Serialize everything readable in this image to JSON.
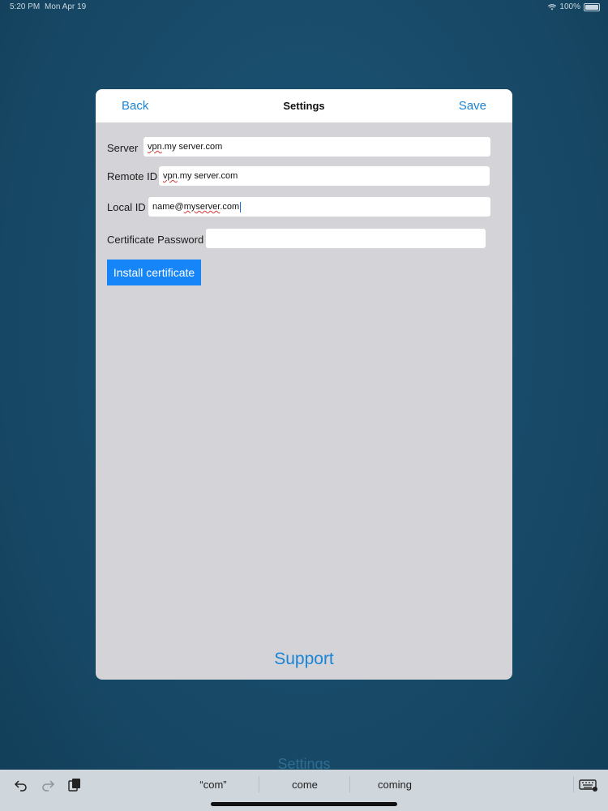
{
  "status_bar": {
    "time": "5:20 PM",
    "date": "Mon Apr 19",
    "battery": "100%"
  },
  "background_title": "Settings",
  "navbar": {
    "back": "Back",
    "title": "Settings",
    "save": "Save"
  },
  "form": {
    "server": {
      "label": "Server",
      "value_prefix": "vpn",
      "value_rest": ".my server.com"
    },
    "remote_id": {
      "label": "Remote ID",
      "value_prefix": "vpn",
      "value_rest": ".my server.com"
    },
    "local_id": {
      "label": "Local ID",
      "value_a": "name@",
      "value_b": "myserver",
      "value_c": ".com"
    },
    "certificate_password": {
      "label": "Certificate Password",
      "value": ""
    },
    "install_button": "Install certificate"
  },
  "support_link": "Support",
  "keyboard_bar": {
    "suggestions": [
      "“com”",
      "come",
      "coming"
    ]
  },
  "colors": {
    "accent": "#1a83d6",
    "button": "#1685f8",
    "panel": "#d3d3d8",
    "background": "#1d4f6e"
  }
}
